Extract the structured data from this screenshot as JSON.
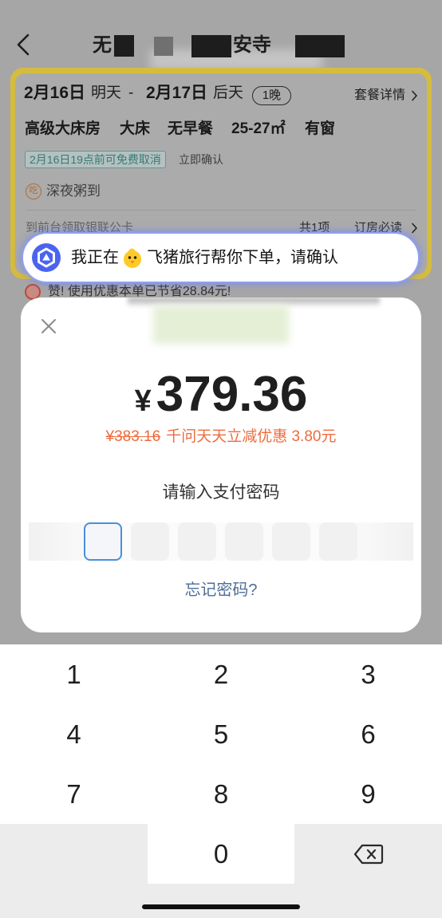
{
  "colors": {
    "page_dim": "#a6a6a6",
    "card_yellow": "#d5bc3e",
    "discount_orange": "#ef6b3d",
    "focus_blue": "#4a8fd9",
    "link_blue": "#4f6e98",
    "agent_blue": "#4a64f0",
    "fliggy_yellow": "#ffc928"
  },
  "header": {
    "back_icon": "chevron-left-icon",
    "title_fragments": [
      "无",
      "安寺"
    ]
  },
  "booking_card": {
    "checkin_date": "2月16日",
    "checkin_day": "明天",
    "date_separator": "-",
    "checkout_date": "2月17日",
    "checkout_day": "后天",
    "nights": "1晚",
    "package_details": "套餐详情",
    "room_type": "高级大床房",
    "bed_type": "大床",
    "breakfast": "无早餐",
    "room_area": "25-27㎡",
    "window": "有窗",
    "cancellation_tag": "2月16日19点前可免费取消",
    "confirmation_tag": "立即确认",
    "perk_icon_label": "吃",
    "perk": "深夜粥到",
    "notice_item": "到前台领取银联公卡",
    "notice_count": "共1项",
    "booking_notice": "订房必读"
  },
  "savings_notice": "赞! 使用优惠本单已节省28.84元!",
  "agent_banner": {
    "logo_icon": "assistant-logo-icon",
    "prefix": "我正在",
    "app_icon": "fliggy-logo-icon",
    "message": "飞猪旅行帮你下单，请确认"
  },
  "payment_dialog": {
    "close_icon": "close-icon",
    "currency_symbol": "¥",
    "amount": "379.36",
    "original_price": "¥383.16",
    "discount": "千问天天立减优惠 3.80元",
    "prompt": "请输入支付密码",
    "forgot_password": "忘记密码?"
  },
  "keypad": {
    "keys": [
      "1",
      "2",
      "3",
      "4",
      "5",
      "6",
      "7",
      "8",
      "9",
      "0"
    ],
    "delete_icon": "backspace-icon"
  }
}
